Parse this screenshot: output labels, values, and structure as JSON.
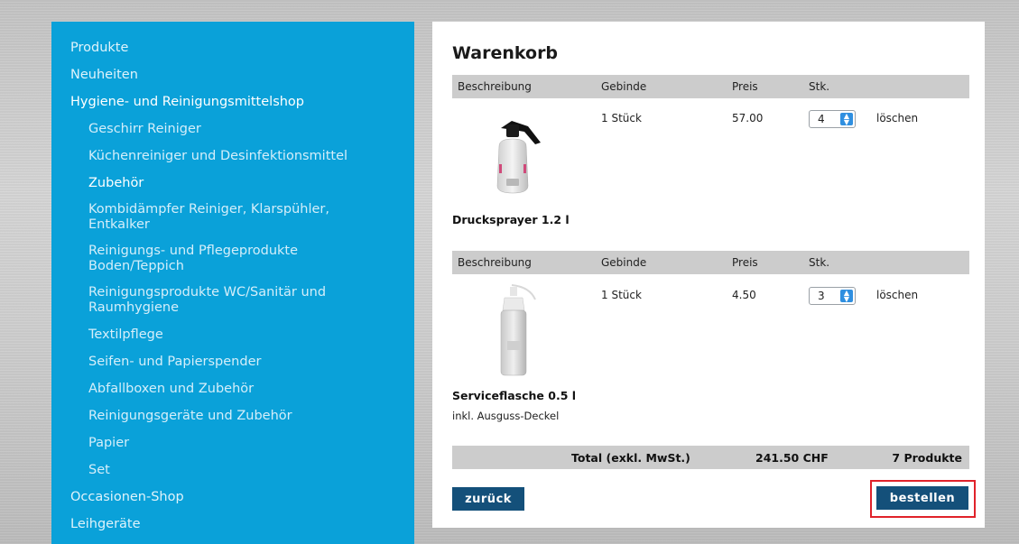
{
  "sidebar": {
    "items": [
      {
        "label": "Produkte",
        "level": 0
      },
      {
        "label": "Neuheiten",
        "level": 0
      },
      {
        "label": "Hygiene- und Reinigungsmittelshop",
        "level": 0
      },
      {
        "label": "Geschirr Reiniger",
        "level": 1
      },
      {
        "label": "Küchenreiniger und Desinfektionsmittel",
        "level": 1
      },
      {
        "label": "Zubehör",
        "level": 1
      },
      {
        "label": "Kombidämpfer Reiniger, Klarspühler, Entkalker",
        "level": 1
      },
      {
        "label": "Reinigungs- und Pflegeprodukte Boden/Teppich",
        "level": 1
      },
      {
        "label": "Reinigungsprodukte WC/Sanitär und Raumhygiene",
        "level": 1
      },
      {
        "label": "Textilpflege",
        "level": 1
      },
      {
        "label": "Seifen- und Papierspender",
        "level": 1
      },
      {
        "label": "Abfallboxen und Zubehör",
        "level": 1
      },
      {
        "label": "Reinigungsgeräte und Zubehör",
        "level": 1
      },
      {
        "label": "Papier",
        "level": 1
      },
      {
        "label": "Set",
        "level": 1
      },
      {
        "label": "Occasionen-Shop",
        "level": 0
      },
      {
        "label": "Leihgeräte",
        "level": 0
      }
    ]
  },
  "cart": {
    "title": "Warenkorb",
    "columns": {
      "description": "Beschreibung",
      "package": "Gebinde",
      "price": "Preis",
      "qty": "Stk."
    },
    "items": [
      {
        "name": "Drucksprayer 1.2 l",
        "note": "",
        "package": "1 Stück",
        "price": "57.00",
        "qty": "4",
        "delete_label": "löschen"
      },
      {
        "name": "Serviceflasche 0.5 l",
        "note": "inkl. Ausguss-Deckel",
        "package": "1 Stück",
        "price": "4.50",
        "qty": "3",
        "delete_label": "löschen"
      }
    ],
    "total": {
      "label": "Total (exkl. MwSt.)",
      "amount": "241.50 CHF",
      "count": "7 Produkte"
    },
    "back_label": "zurück",
    "order_label": "bestellen"
  },
  "colors": {
    "sidebar": "#0aa1d9",
    "button": "#14507a",
    "highlight": "#e0222a",
    "header_row": "#cccccc"
  }
}
